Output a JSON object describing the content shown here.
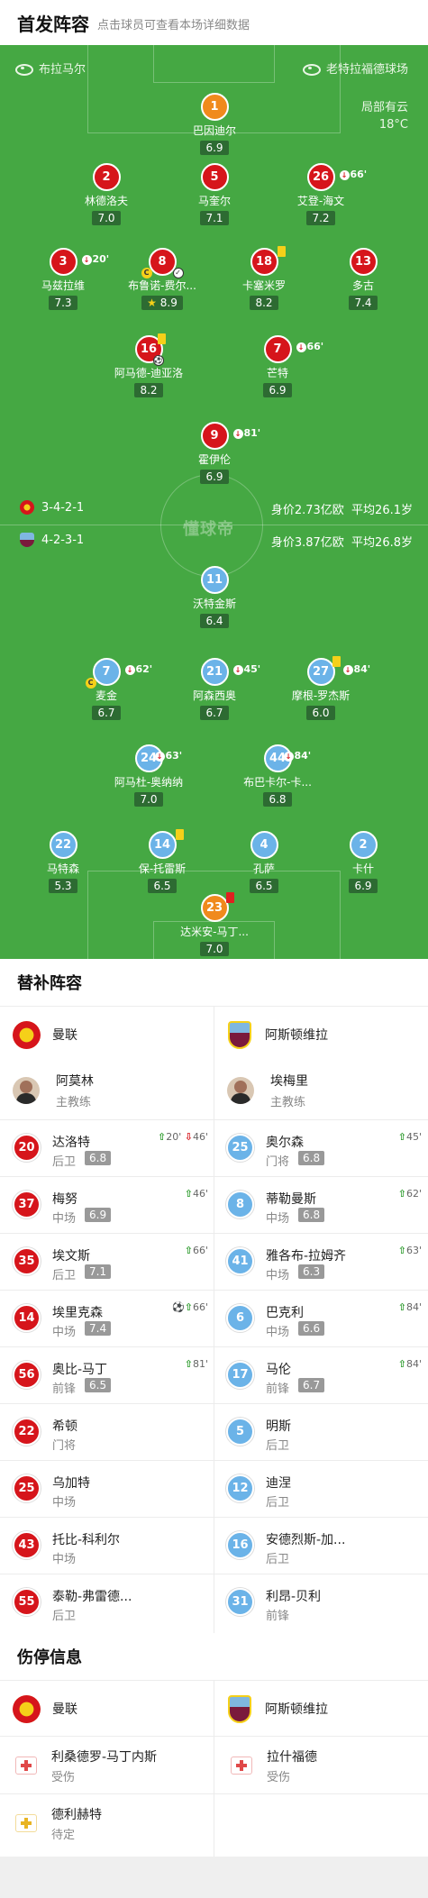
{
  "header": {
    "title": "首发阵容",
    "hint": "点击球员可查看本场详细数据"
  },
  "pitch": {
    "home_stadium": "布拉马尔",
    "away_stadium": "老特拉福德球场",
    "weather": "局部有云",
    "temperature": "18°C",
    "watermark": "懂球帝",
    "home_formation": "3-4-2-1",
    "home_value": "身价2.73亿欧",
    "home_age": "平均26.1岁",
    "away_formation": "4-2-3-1",
    "away_value": "身价3.87亿欧",
    "away_age": "平均26.8岁"
  },
  "home_players": [
    {
      "num": "1",
      "name": "巴因迪尔",
      "rating": "6.9"
    },
    {
      "num": "2",
      "name": "林德洛夫",
      "rating": "7.0"
    },
    {
      "num": "5",
      "name": "马奎尔",
      "rating": "7.1"
    },
    {
      "num": "26",
      "name": "艾登-海文",
      "rating": "7.2",
      "sub": "66'"
    },
    {
      "num": "3",
      "name": "马兹拉维",
      "rating": "7.3",
      "sub": "20'"
    },
    {
      "num": "8",
      "name": "布鲁诺-费尔...",
      "rating": "8.9"
    },
    {
      "num": "18",
      "name": "卡塞米罗",
      "rating": "8.2"
    },
    {
      "num": "13",
      "name": "多古",
      "rating": "7.4"
    },
    {
      "num": "16",
      "name": "阿马德-迪亚洛",
      "rating": "8.2"
    },
    {
      "num": "7",
      "name": "芒特",
      "rating": "6.9",
      "sub": "66'"
    },
    {
      "num": "9",
      "name": "霍伊伦",
      "rating": "6.9",
      "sub": "81'"
    }
  ],
  "away_players": [
    {
      "num": "11",
      "name": "沃特金斯",
      "rating": "6.4"
    },
    {
      "num": "7",
      "name": "麦金",
      "rating": "6.7",
      "sub": "62'"
    },
    {
      "num": "21",
      "name": "阿森西奥",
      "rating": "6.7",
      "sub": "45'"
    },
    {
      "num": "27",
      "name": "摩根-罗杰斯",
      "rating": "6.0",
      "sub": "84'"
    },
    {
      "num": "24",
      "name": "阿马杜-奥纳纳",
      "rating": "7.0",
      "sub": "63'"
    },
    {
      "num": "44",
      "name": "布巴卡尔-卡...",
      "rating": "6.8",
      "sub": "84'"
    },
    {
      "num": "22",
      "name": "马特森",
      "rating": "5.3"
    },
    {
      "num": "14",
      "name": "保-托雷斯",
      "rating": "6.5"
    },
    {
      "num": "4",
      "name": "孔萨",
      "rating": "6.5"
    },
    {
      "num": "2",
      "name": "卡什",
      "rating": "6.9"
    },
    {
      "num": "23",
      "name": "达米安-马丁...",
      "rating": "7.0"
    }
  ],
  "subs_section": {
    "title": "替补阵容",
    "home_team": "曼联",
    "away_team": "阿斯顿维拉",
    "home_coach": {
      "name": "阿莫林",
      "role": "主教练"
    },
    "away_coach": {
      "name": "埃梅里",
      "role": "主教练"
    },
    "home": [
      {
        "num": "20",
        "name": "达洛特",
        "pos": "后卫",
        "rating": "6.8",
        "ev": "20'",
        "ev2": "46'"
      },
      {
        "num": "37",
        "name": "梅努",
        "pos": "中场",
        "rating": "6.9",
        "ev": "46'"
      },
      {
        "num": "35",
        "name": "埃文斯",
        "pos": "后卫",
        "rating": "7.1",
        "ev": "66'"
      },
      {
        "num": "14",
        "name": "埃里克森",
        "pos": "中场",
        "rating": "7.4",
        "ev": "66'"
      },
      {
        "num": "56",
        "name": "奥比-马丁",
        "pos": "前锋",
        "rating": "6.5",
        "ev": "81'"
      },
      {
        "num": "22",
        "name": "希顿",
        "pos": "门将"
      },
      {
        "num": "25",
        "name": "乌加特",
        "pos": "中场"
      },
      {
        "num": "43",
        "name": "托比-科利尔",
        "pos": "中场"
      },
      {
        "num": "55",
        "name": "泰勒-弗雷德...",
        "pos": "后卫"
      }
    ],
    "away": [
      {
        "num": "25",
        "name": "奥尔森",
        "pos": "门将",
        "rating": "6.8",
        "ev": "45'"
      },
      {
        "num": "8",
        "name": "蒂勒曼斯",
        "pos": "中场",
        "rating": "6.8",
        "ev": "62'"
      },
      {
        "num": "41",
        "name": "雅各布-拉姆齐",
        "pos": "中场",
        "rating": "6.3",
        "ev": "63'"
      },
      {
        "num": "6",
        "name": "巴克利",
        "pos": "中场",
        "rating": "6.6",
        "ev": "84'"
      },
      {
        "num": "17",
        "name": "马伦",
        "pos": "前锋",
        "rating": "6.7",
        "ev": "84'"
      },
      {
        "num": "5",
        "name": "明斯",
        "pos": "后卫"
      },
      {
        "num": "12",
        "name": "迪涅",
        "pos": "后卫"
      },
      {
        "num": "16",
        "name": "安德烈斯-加...",
        "pos": "后卫"
      },
      {
        "num": "31",
        "name": "利昂-贝利",
        "pos": "前锋"
      }
    ]
  },
  "injury_section": {
    "title": "伤停信息",
    "home_team": "曼联",
    "away_team": "阿斯顿维拉",
    "home": [
      {
        "name": "利桑德罗-马丁内斯",
        "status": "受伤"
      },
      {
        "name": "德利赫特",
        "status": "待定"
      }
    ],
    "away": [
      {
        "name": "拉什福德",
        "status": "受伤"
      }
    ]
  },
  "colors": {
    "pitch": "#45a843",
    "home": "#d6151b",
    "away": "#6bb3e8",
    "gk_home": "#f08a1d"
  }
}
